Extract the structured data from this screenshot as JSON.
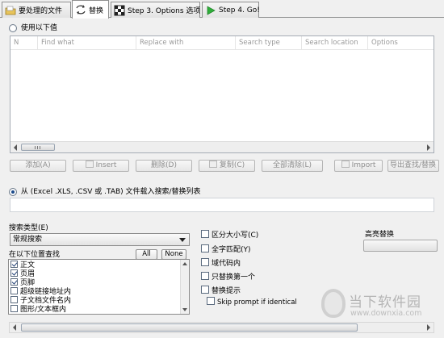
{
  "tabs": [
    {
      "label": "要处理的文件",
      "icon": "folder-icon",
      "active": false
    },
    {
      "label": "替换",
      "icon": "replace-arrows-icon",
      "active": true
    },
    {
      "label": "Step 3. Options 选项",
      "icon": "options-grid-icon",
      "active": false
    },
    {
      "label": "Step 4. Go!",
      "icon": "play-icon",
      "active": false
    }
  ],
  "use_values_radio": {
    "label": "使用以下值",
    "selected": false
  },
  "replace_list": {
    "columns": [
      "N",
      "Find what",
      "Replace with",
      "Search type",
      "Search location",
      "Options"
    ],
    "rows": []
  },
  "actions": {
    "add": "添加(A)",
    "insert": "Insert",
    "delete": "删除(D)",
    "copy": "复制(C)",
    "clear_all": "全部清除(L)",
    "import": "Import",
    "export": "导出查找/替换"
  },
  "file_radio": {
    "label": "从 (Excel .XLS, .CSV 或 .TAB) 文件载入搜索/替换列表",
    "selected": true
  },
  "file_path": "",
  "search_type": {
    "label": "搜索类型(E)",
    "value": "常规搜索"
  },
  "locations": {
    "label": "在以下位置查找",
    "all_button": "All",
    "none_button": "None",
    "items": [
      {
        "label": "正文",
        "checked": true
      },
      {
        "label": "页眉",
        "checked": true
      },
      {
        "label": "页脚",
        "checked": true
      },
      {
        "label": "超级链接地址内",
        "checked": false
      },
      {
        "label": "子文档文件名内",
        "checked": false
      },
      {
        "label": "图形/文本框内",
        "checked": false
      }
    ]
  },
  "options": {
    "match_case": {
      "label": "区分大小写(C)",
      "checked": false
    },
    "whole_word": {
      "label": "全字匹配(Y)",
      "checked": false
    },
    "field_codes": {
      "label": "域代码内",
      "checked": false
    },
    "first_only": {
      "label": "只替换第一个",
      "checked": false
    },
    "prompt": {
      "label": "替换提示",
      "checked": false
    },
    "skip_prompt": {
      "label": "Skip prompt if identical",
      "checked": false
    }
  },
  "highlight": {
    "label": "高亮替换"
  },
  "watermark": {
    "text": "当下软件园",
    "url": "www.downxia.com"
  }
}
